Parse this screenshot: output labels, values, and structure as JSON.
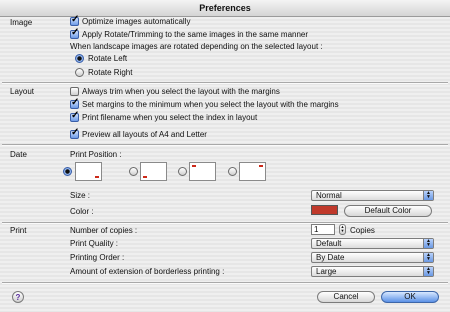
{
  "window": {
    "title": "Preferences"
  },
  "image": {
    "label": "Image",
    "optimize": {
      "label": "Optimize images automatically",
      "checked": true
    },
    "apply_rotate": {
      "label": "Apply Rotate/Trimming to the same images in the same manner",
      "checked": true
    },
    "landscape_text": "When landscape images are rotated depending on the selected layout :",
    "rotate_left": {
      "label": "Rotate Left",
      "selected": true
    },
    "rotate_right": {
      "label": "Rotate Right",
      "selected": false
    }
  },
  "layout": {
    "label": "Layout",
    "always_trim": {
      "label": "Always trim when you select the layout with the margins",
      "checked": false
    },
    "set_margins": {
      "label": "Set margins to the minimum when you select the layout with the margins",
      "checked": true
    },
    "print_filename": {
      "label": "Print filename when you select the index in layout",
      "checked": true
    },
    "preview_all": {
      "label": "Preview all layouts of A4 and Letter",
      "checked": true
    }
  },
  "date": {
    "label": "Date",
    "print_position_label": "Print Position :",
    "positions": [
      {
        "name": "bottom-right",
        "selected": true
      },
      {
        "name": "bottom-left",
        "selected": false
      },
      {
        "name": "top-left",
        "selected": false
      },
      {
        "name": "top-right",
        "selected": false
      }
    ],
    "size_label": "Size :",
    "size_value": "Normal",
    "color_label": "Color :",
    "color_hex": "#c0392b",
    "default_color_button": "Default Color"
  },
  "print": {
    "label": "Print",
    "copies_label": "Number of copies :",
    "copies_value": "1",
    "copies_unit": "Copies",
    "quality_label": "Print Quality :",
    "quality_value": "Default",
    "order_label": "Printing Order :",
    "order_value": "By Date",
    "extension_label": "Amount of extension of borderless printing :",
    "extension_value": "Large"
  },
  "footer": {
    "help": "?",
    "cancel": "Cancel",
    "ok": "OK"
  },
  "icons": {
    "help": "help-icon",
    "select_arrows": "up-down-arrows-icon",
    "stepper": "stepper-icon"
  }
}
